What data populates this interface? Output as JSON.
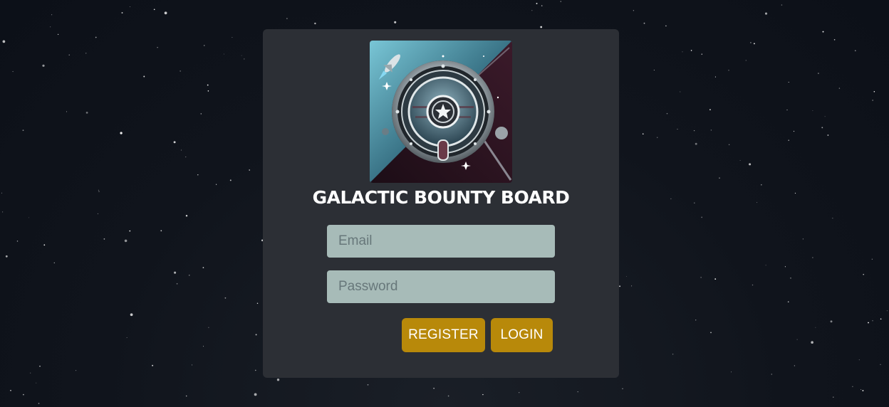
{
  "app": {
    "title": "GALACTIC BOUNTY BOARD",
    "logo_icon": "space-emblem-icon"
  },
  "login_form": {
    "email": {
      "value": "",
      "placeholder": "Email"
    },
    "password": {
      "value": "",
      "placeholder": "Password"
    },
    "register_label": "REGISTER",
    "login_label": "LOGIN"
  },
  "colors": {
    "background": "#10141c",
    "card": "#2c2f35",
    "input_background": "#a7bbb8",
    "button": "#b8890a",
    "button_text": "#ffffff",
    "title_text": "#ffffff"
  }
}
